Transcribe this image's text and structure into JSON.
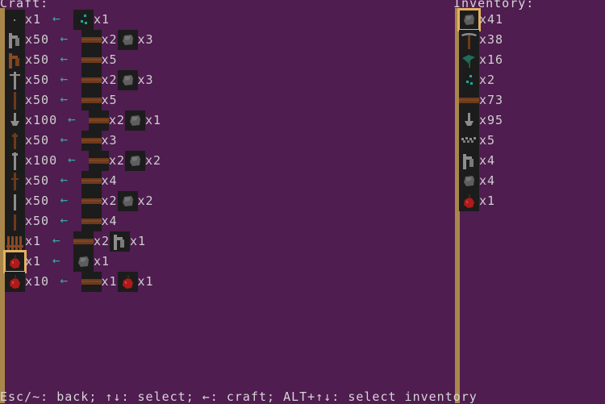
{
  "craft": {
    "header": "Craft:",
    "rows": [
      {
        "out_icon": "dot-icon",
        "out_qty": "x1",
        "ings": [
          {
            "icon": "sapling-icon",
            "qty": "x1"
          }
        ]
      },
      {
        "out_icon": "iron-door-icon",
        "out_qty": "x50",
        "ings": [
          {
            "icon": "wood-plank-icon",
            "qty": "x2"
          },
          {
            "icon": "stone-icon",
            "qty": "x3"
          }
        ]
      },
      {
        "out_icon": "wood-door-icon",
        "out_qty": "x50",
        "ings": [
          {
            "icon": "wood-plank-icon",
            "qty": "x5"
          }
        ]
      },
      {
        "out_icon": "stone-post-icon",
        "out_qty": "x50",
        "ings": [
          {
            "icon": "wood-plank-icon",
            "qty": "x2"
          },
          {
            "icon": "stone-icon",
            "qty": "x3"
          }
        ]
      },
      {
        "out_icon": "wood-post-icon",
        "out_qty": "x50",
        "ings": [
          {
            "icon": "wood-plank-icon",
            "qty": "x5"
          }
        ]
      },
      {
        "out_icon": "stone-torch-icon",
        "out_qty": "x100",
        "ings": [
          {
            "icon": "wood-plank-icon",
            "qty": "x2"
          },
          {
            "icon": "stone-icon",
            "qty": "x1"
          }
        ]
      },
      {
        "out_icon": "wood-beam-icon",
        "out_qty": "x50",
        "ings": [
          {
            "icon": "wood-plank-icon",
            "qty": "x3"
          }
        ]
      },
      {
        "out_icon": "stone-pillar-icon",
        "out_qty": "x100",
        "ings": [
          {
            "icon": "wood-plank-icon",
            "qty": "x2"
          },
          {
            "icon": "stone-icon",
            "qty": "x2"
          }
        ]
      },
      {
        "out_icon": "wood-fence-icon",
        "out_qty": "x50",
        "ings": [
          {
            "icon": "wood-plank-icon",
            "qty": "x4"
          }
        ]
      },
      {
        "out_icon": "stone-rod-icon",
        "out_qty": "x50",
        "ings": [
          {
            "icon": "wood-plank-icon",
            "qty": "x2"
          },
          {
            "icon": "stone-icon",
            "qty": "x2"
          }
        ]
      },
      {
        "out_icon": "wood-rod-icon",
        "out_qty": "x50",
        "ings": [
          {
            "icon": "wood-plank-icon",
            "qty": "x4"
          }
        ]
      },
      {
        "out_icon": "wood-bed-icon",
        "out_qty": "x1",
        "ings": [
          {
            "icon": "wood-plank-icon",
            "qty": "x2"
          },
          {
            "icon": "iron-door-icon",
            "qty": "x1"
          }
        ]
      },
      {
        "out_icon": "red-apple-icon",
        "out_qty": "x1",
        "ings": [
          {
            "icon": "stone-icon",
            "qty": "x1"
          }
        ],
        "selected": true
      },
      {
        "out_icon": "red-apple-icon",
        "out_qty": "x10",
        "ings": [
          {
            "icon": "wood-plank-icon",
            "qty": "x1"
          },
          {
            "icon": "red-apple-icon",
            "qty": "x1"
          }
        ]
      }
    ]
  },
  "inventory": {
    "header": "Inventory:",
    "items": [
      {
        "icon": "stone-icon",
        "qty": "x41",
        "selected": true
      },
      {
        "icon": "pickaxe-icon",
        "qty": "x38"
      },
      {
        "icon": "green-plant-icon",
        "qty": "x16"
      },
      {
        "icon": "sapling-icon",
        "qty": "x2"
      },
      {
        "icon": "wood-plank-icon",
        "qty": "x73"
      },
      {
        "icon": "stone-torch-icon",
        "qty": "x95"
      },
      {
        "icon": "gravel-icon",
        "qty": "x5"
      },
      {
        "icon": "iron-door-icon",
        "qty": "x4"
      },
      {
        "icon": "stone-icon",
        "qty": "x4"
      },
      {
        "icon": "red-apple-icon",
        "qty": "x1"
      }
    ]
  },
  "footer": "Esc/~: back; ↑↓: select; ←: craft; ALT+↑↓: select inventory",
  "colors": {
    "background": "#4f1d4f",
    "accent": "#e4b060",
    "arrow": "#3aa6a0"
  }
}
